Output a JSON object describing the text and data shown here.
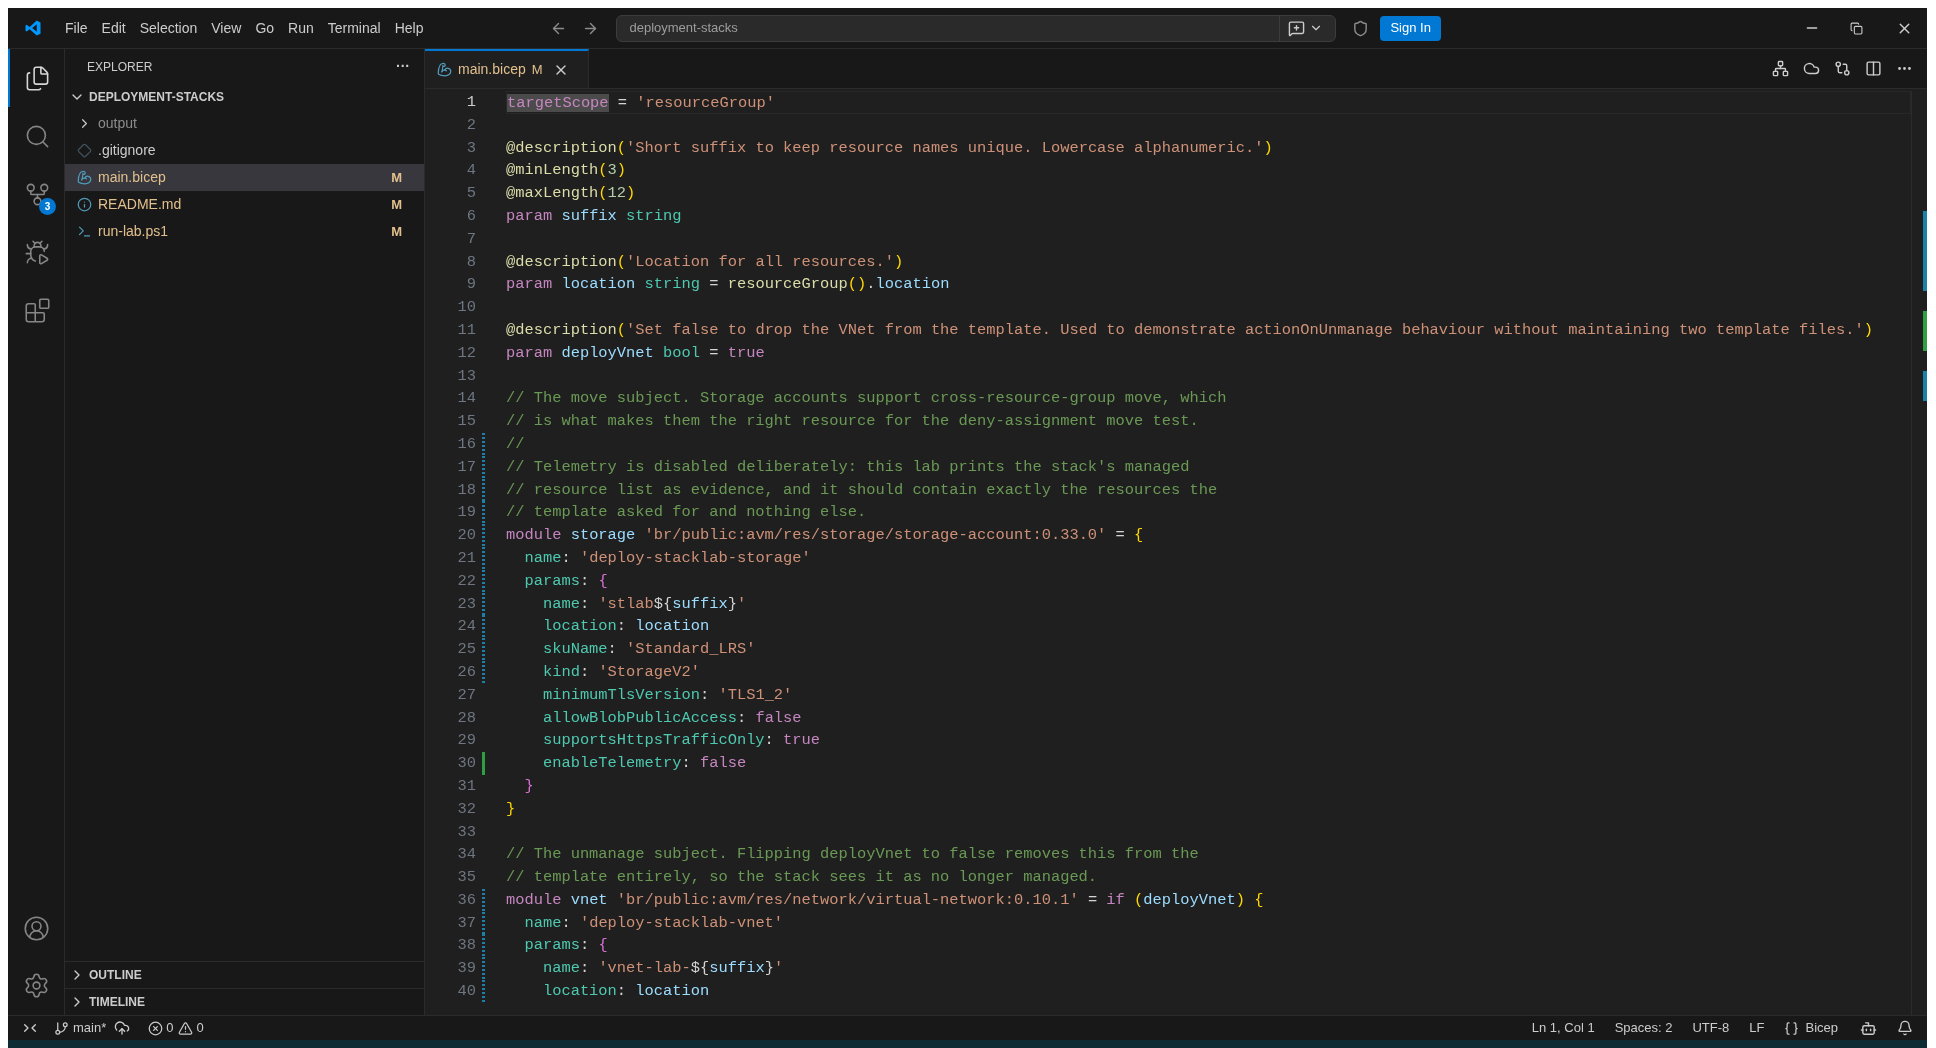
{
  "title_bar": {
    "menu": [
      "File",
      "Edit",
      "Selection",
      "View",
      "Go",
      "Run",
      "Terminal",
      "Help"
    ],
    "command_center": "deployment-stacks",
    "sign_in": "Sign In"
  },
  "activity_bar": {
    "items": [
      {
        "kind": "explorer",
        "selected": true
      },
      {
        "kind": "search",
        "selected": false
      },
      {
        "kind": "source-control",
        "selected": false,
        "badge": "3"
      },
      {
        "kind": "run",
        "selected": false
      },
      {
        "kind": "extensions",
        "selected": false
      }
    ]
  },
  "sidebar": {
    "title": "EXPLORER",
    "more": "···",
    "folder": "DEPLOYMENT-STACKS",
    "items": [
      {
        "kind": "folder",
        "name": "output",
        "ignored": true,
        "selected": false
      },
      {
        "kind": "git",
        "name": ".gitignore",
        "ignored": false,
        "selected": false
      },
      {
        "kind": "bicep",
        "name": "main.bicep",
        "ignored": false,
        "selected": true,
        "status": "M"
      },
      {
        "kind": "info",
        "name": "README.md",
        "ignored": false,
        "selected": false,
        "status": "M"
      },
      {
        "kind": "powershell",
        "name": "run-lab.ps1",
        "ignored": false,
        "selected": false,
        "status": "M"
      }
    ],
    "sections": [
      "OUTLINE",
      "TIMELINE"
    ]
  },
  "tab": {
    "label": "main.bicep",
    "status": "M"
  },
  "lines": [
    {
      "number": "1",
      "current": true,
      "tokens": [
        {
          "kind": "keyword",
          "text": "targetScope",
          "highlighted": true
        },
        {
          "kind": "plain",
          "text": " = "
        },
        {
          "kind": "string",
          "text": "'resourceGroup'"
        }
      ]
    },
    {
      "number": "2",
      "current": false
    },
    {
      "number": "3",
      "current": false,
      "tokens": [
        {
          "kind": "decorator",
          "text": "@description"
        },
        {
          "kind": "bracket",
          "text": "("
        },
        {
          "kind": "string",
          "text": "'Short suffix to keep resource names unique. Lowercase alphanumeric.'"
        },
        {
          "kind": "bracket",
          "text": ")"
        }
      ]
    },
    {
      "number": "4",
      "current": false,
      "tokens": [
        {
          "kind": "decorator",
          "text": "@minLength"
        },
        {
          "kind": "bracket",
          "text": "("
        },
        {
          "kind": "number",
          "text": "3"
        },
        {
          "kind": "bracket",
          "text": ")"
        }
      ]
    },
    {
      "number": "5",
      "current": false,
      "tokens": [
        {
          "kind": "decorator",
          "text": "@maxLength"
        },
        {
          "kind": "bracket",
          "text": "("
        },
        {
          "kind": "number",
          "text": "12"
        },
        {
          "kind": "bracket",
          "text": ")"
        }
      ]
    },
    {
      "number": "6",
      "current": false,
      "tokens": [
        {
          "kind": "keyword",
          "text": "param "
        },
        {
          "kind": "ident",
          "text": "suffix "
        },
        {
          "kind": "type",
          "text": "string"
        }
      ]
    },
    {
      "number": "7",
      "current": false
    },
    {
      "number": "8",
      "current": false,
      "tokens": [
        {
          "kind": "decorator",
          "text": "@description"
        },
        {
          "kind": "bracket",
          "text": "("
        },
        {
          "kind": "string",
          "text": "'Location for all resources.'"
        },
        {
          "kind": "bracket",
          "text": ")"
        }
      ]
    },
    {
      "number": "9",
      "current": false,
      "tokens": [
        {
          "kind": "keyword",
          "text": "param "
        },
        {
          "kind": "ident",
          "text": "location "
        },
        {
          "kind": "type",
          "text": "string"
        },
        {
          "kind": "plain",
          "text": " = "
        },
        {
          "kind": "func",
          "text": "resourceGroup"
        },
        {
          "kind": "bracket",
          "text": "()"
        },
        {
          "kind": "plain",
          "text": "."
        },
        {
          "kind": "ident",
          "text": "location"
        }
      ]
    },
    {
      "number": "10",
      "current": false
    },
    {
      "number": "11",
      "current": false,
      "tokens": [
        {
          "kind": "decorator",
          "text": "@description"
        },
        {
          "kind": "bracket",
          "text": "("
        },
        {
          "kind": "string",
          "text": "'Set false to drop the VNet from the template. Used to demonstrate actionOnUnmanage behaviour without maintaining two template files.'"
        },
        {
          "kind": "bracket",
          "text": ")"
        }
      ]
    },
    {
      "number": "12",
      "current": false,
      "tokens": [
        {
          "kind": "keyword",
          "text": "param "
        },
        {
          "kind": "ident",
          "text": "deployVnet "
        },
        {
          "kind": "type",
          "text": "bool"
        },
        {
          "kind": "plain",
          "text": " = "
        },
        {
          "kind": "keyword",
          "text": "true"
        }
      ]
    },
    {
      "number": "13",
      "current": false
    },
    {
      "number": "14",
      "current": false,
      "tokens": [
        {
          "kind": "comment",
          "text": "// The move subject. Storage accounts support cross-resource-group move, which"
        }
      ]
    },
    {
      "number": "15",
      "current": false,
      "tokens": [
        {
          "kind": "comment",
          "text": "// is what makes them the right resource for the deny-assignment move test."
        }
      ]
    },
    {
      "number": "16",
      "current": false,
      "modified": true,
      "tokens": [
        {
          "kind": "comment",
          "text": "//"
        }
      ]
    },
    {
      "number": "17",
      "current": false,
      "modified": true,
      "tokens": [
        {
          "kind": "comment",
          "text": "// Telemetry is disabled deliberately: this lab prints the stack's managed"
        }
      ]
    },
    {
      "number": "18",
      "current": false,
      "modified": true,
      "tokens": [
        {
          "kind": "comment",
          "text": "// resource list as evidence, and it should contain exactly the resources the"
        }
      ]
    },
    {
      "number": "19",
      "current": false,
      "modified": true,
      "tokens": [
        {
          "kind": "comment",
          "text": "// template asked for and nothing else."
        }
      ]
    },
    {
      "number": "20",
      "current": false,
      "modified": true,
      "tokens": [
        {
          "kind": "keyword",
          "text": "module "
        },
        {
          "kind": "ident",
          "text": "storage "
        },
        {
          "kind": "string",
          "text": "'br/public:avm/res/storage/storage-account:0.33.0'"
        },
        {
          "kind": "plain",
          "text": " = "
        },
        {
          "kind": "bracket",
          "text": "{"
        }
      ]
    },
    {
      "number": "21",
      "current": false,
      "modified": true,
      "tokens": [
        {
          "kind": "prop",
          "text": "  name"
        },
        {
          "kind": "plain",
          "text": ": "
        },
        {
          "kind": "string",
          "text": "'deploy-stacklab-storage'"
        }
      ]
    },
    {
      "number": "22",
      "current": false,
      "modified": true,
      "tokens": [
        {
          "kind": "prop",
          "text": "  params"
        },
        {
          "kind": "plain",
          "text": ": "
        },
        {
          "kind": "bracket2",
          "text": "{"
        }
      ]
    },
    {
      "number": "23",
      "current": false,
      "modified": true,
      "tokens": [
        {
          "kind": "prop",
          "text": "    name"
        },
        {
          "kind": "plain",
          "text": ": "
        },
        {
          "kind": "string",
          "text": "'stlab"
        },
        {
          "kind": "plain",
          "text": "${"
        },
        {
          "kind": "ident",
          "text": "suffix"
        },
        {
          "kind": "plain",
          "text": "}"
        },
        {
          "kind": "string",
          "text": "'"
        }
      ]
    },
    {
      "number": "24",
      "current": false,
      "modified": true,
      "tokens": [
        {
          "kind": "prop",
          "text": "    location"
        },
        {
          "kind": "plain",
          "text": ": "
        },
        {
          "kind": "ident",
          "text": "location"
        }
      ]
    },
    {
      "number": "25",
      "current": false,
      "modified": true,
      "tokens": [
        {
          "kind": "prop",
          "text": "    skuName"
        },
        {
          "kind": "plain",
          "text": ": "
        },
        {
          "kind": "string",
          "text": "'Standard_LRS'"
        }
      ]
    },
    {
      "number": "26",
      "current": false,
      "modified": true,
      "tokens": [
        {
          "kind": "prop",
          "text": "    kind"
        },
        {
          "kind": "plain",
          "text": ": "
        },
        {
          "kind": "string",
          "text": "'StorageV2'"
        }
      ]
    },
    {
      "number": "27",
      "current": false,
      "tokens": [
        {
          "kind": "prop",
          "text": "    minimumTlsVersion"
        },
        {
          "kind": "plain",
          "text": ": "
        },
        {
          "kind": "string",
          "text": "'TLS1_2'"
        }
      ]
    },
    {
      "number": "28",
      "current": false,
      "tokens": [
        {
          "kind": "prop",
          "text": "    allowBlobPublicAccess"
        },
        {
          "kind": "plain",
          "text": ": "
        },
        {
          "kind": "keyword",
          "text": "false"
        }
      ]
    },
    {
      "number": "29",
      "current": false,
      "tokens": [
        {
          "kind": "prop",
          "text": "    supportsHttpsTrafficOnly"
        },
        {
          "kind": "plain",
          "text": ": "
        },
        {
          "kind": "keyword",
          "text": "true"
        }
      ]
    },
    {
      "number": "30",
      "current": false,
      "added": true,
      "tokens": [
        {
          "kind": "prop",
          "text": "    enableTelemetry"
        },
        {
          "kind": "plain",
          "text": ": "
        },
        {
          "kind": "keyword",
          "text": "false"
        }
      ]
    },
    {
      "number": "31",
      "current": false,
      "tokens": [
        {
          "kind": "bracket2",
          "text": "  }"
        }
      ]
    },
    {
      "number": "32",
      "current": false,
      "tokens": [
        {
          "kind": "bracket",
          "text": "}"
        }
      ]
    },
    {
      "number": "33",
      "current": false
    },
    {
      "number": "34",
      "current": false,
      "tokens": [
        {
          "kind": "comment",
          "text": "// The unmanage subject. Flipping deployVnet to false removes this from the"
        }
      ]
    },
    {
      "number": "35",
      "current": false,
      "tokens": [
        {
          "kind": "comment",
          "text": "// template entirely, so the stack sees it as no longer managed."
        }
      ]
    },
    {
      "number": "36",
      "current": false,
      "modified": true,
      "tokens": [
        {
          "kind": "keyword",
          "text": "module "
        },
        {
          "kind": "ident",
          "text": "vnet "
        },
        {
          "kind": "string",
          "text": "'br/public:avm/res/network/virtual-network:0.10.1'"
        },
        {
          "kind": "plain",
          "text": " = "
        },
        {
          "kind": "keyword",
          "text": "if "
        },
        {
          "kind": "bracket",
          "text": "("
        },
        {
          "kind": "ident",
          "text": "deployVnet"
        },
        {
          "kind": "bracket",
          "text": ") {"
        }
      ]
    },
    {
      "number": "37",
      "current": false,
      "modified": true,
      "tokens": [
        {
          "kind": "prop",
          "text": "  name"
        },
        {
          "kind": "plain",
          "text": ": "
        },
        {
          "kind": "string",
          "text": "'deploy-stacklab-vnet'"
        }
      ]
    },
    {
      "number": "38",
      "current": false,
      "modified": true,
      "tokens": [
        {
          "kind": "prop",
          "text": "  params"
        },
        {
          "kind": "plain",
          "text": ": "
        },
        {
          "kind": "bracket2",
          "text": "{"
        }
      ]
    },
    {
      "number": "39",
      "current": false,
      "modified": true,
      "tokens": [
        {
          "kind": "prop",
          "text": "    name"
        },
        {
          "kind": "plain",
          "text": ": "
        },
        {
          "kind": "string",
          "text": "'vnet-lab-"
        },
        {
          "kind": "plain",
          "text": "${"
        },
        {
          "kind": "ident",
          "text": "suffix"
        },
        {
          "kind": "plain",
          "text": "}"
        },
        {
          "kind": "string",
          "text": "'"
        }
      ]
    },
    {
      "number": "40",
      "current": false,
      "modified": true,
      "tokens": [
        {
          "kind": "prop",
          "text": "    location"
        },
        {
          "kind": "plain",
          "text": ": "
        },
        {
          "kind": "ident",
          "text": "location"
        }
      ]
    }
  ],
  "status_bar": {
    "branch": "main*",
    "errors": "0",
    "warnings": "0",
    "right": [
      {
        "kind": "text",
        "text": "Ln 1, Col 1"
      },
      {
        "kind": "text",
        "text": "Spaces: 2"
      },
      {
        "kind": "text",
        "text": "UTF-8"
      },
      {
        "kind": "text",
        "text": "LF"
      },
      {
        "kind": "language",
        "text": "Bicep"
      }
    ]
  }
}
